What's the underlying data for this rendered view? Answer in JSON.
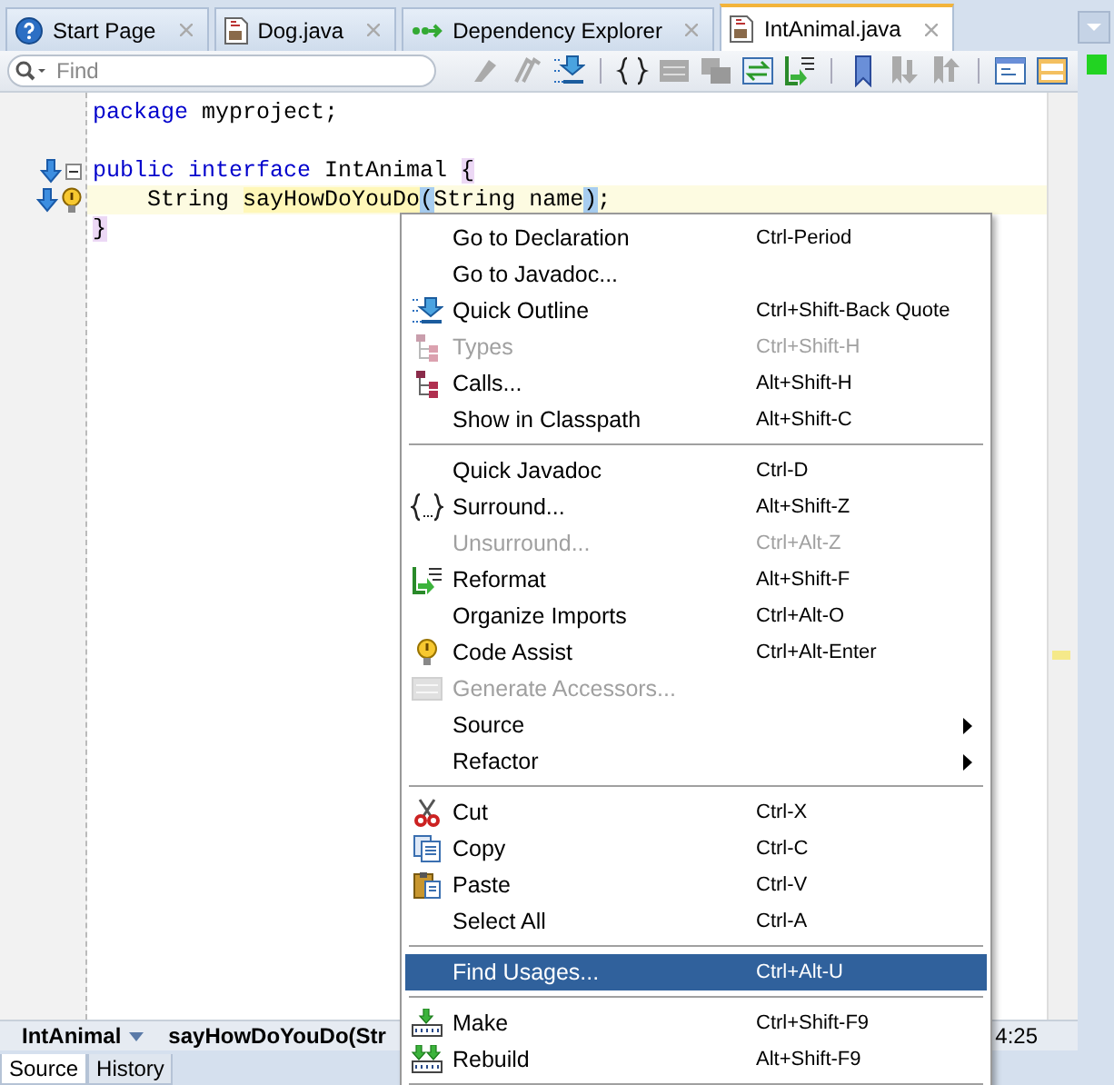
{
  "tabs": [
    {
      "label": "Start Page",
      "selected": false
    },
    {
      "label": "Dog.java",
      "selected": false
    },
    {
      "label": "Dependency Explorer",
      "selected": false
    },
    {
      "label": "IntAnimal.java",
      "selected": true
    }
  ],
  "search": {
    "placeholder": "Find"
  },
  "editor": {
    "lines": [
      {
        "current": false,
        "tokens": [
          {
            "text": "package",
            "kind": "keyword"
          },
          {
            "text": " myproject;",
            "kind": "plain"
          }
        ]
      },
      {
        "current": false,
        "blank_line_before": true,
        "tokens": [
          {
            "text": "public",
            "kind": "keyword"
          },
          {
            "text": " interface",
            "kind": "keyword"
          },
          {
            "text": " IntAnimal ",
            "kind": "plain"
          },
          {
            "text": "{",
            "kind": "brace"
          }
        ]
      },
      {
        "current": true,
        "tokens": [
          {
            "text": "    String ",
            "kind": "plain"
          },
          {
            "text": "sayHowDoYouDo",
            "kind": "mark"
          },
          {
            "text": "(",
            "kind": "paren"
          },
          {
            "text": "String name",
            "kind": "plain"
          },
          {
            "text": ")",
            "kind": "paren"
          },
          {
            "text": ";",
            "kind": "plain"
          }
        ]
      },
      {
        "current": false,
        "tokens": [
          {
            "text": "}",
            "kind": "brace"
          }
        ]
      }
    ]
  },
  "breadcrumb": [
    {
      "label": "IntAnimal",
      "dropdown": true
    },
    {
      "label": "sayHowDoYouDo(Str",
      "dropdown": false
    }
  ],
  "position": "4:25",
  "bottom_tabs": [
    {
      "label": "Source",
      "selected": true
    },
    {
      "label": "History",
      "selected": false
    }
  ],
  "context_menu": [
    {
      "kind": "item",
      "label": "Go to Declaration",
      "shortcut": "Ctrl-Period",
      "disabled": false,
      "selected": false
    },
    {
      "kind": "item",
      "label": "Go to Javadoc...",
      "disabled": false,
      "selected": false
    },
    {
      "kind": "item",
      "label": "Quick Outline",
      "shortcut": "Ctrl+Shift-Back Quote",
      "disabled": false,
      "selected": false
    },
    {
      "kind": "item",
      "label": "Types",
      "shortcut": "Ctrl+Shift-H",
      "disabled": true,
      "selected": false
    },
    {
      "kind": "item",
      "label": "Calls...",
      "shortcut": "Alt+Shift-H",
      "disabled": false,
      "selected": false
    },
    {
      "kind": "item",
      "label": "Show in Classpath",
      "shortcut": "Alt+Shift-C",
      "disabled": false,
      "selected": false
    },
    {
      "kind": "separator"
    },
    {
      "kind": "item",
      "label": "Quick Javadoc",
      "shortcut": "Ctrl-D",
      "disabled": false,
      "selected": false
    },
    {
      "kind": "item",
      "label": "Surround...",
      "shortcut": "Alt+Shift-Z",
      "disabled": false,
      "selected": false
    },
    {
      "kind": "item",
      "label": "Unsurround...",
      "shortcut": "Ctrl+Alt-Z",
      "disabled": true,
      "selected": false
    },
    {
      "kind": "item",
      "label": "Reformat",
      "shortcut": "Alt+Shift-F",
      "disabled": false,
      "selected": false
    },
    {
      "kind": "item",
      "label": "Organize Imports",
      "shortcut": "Ctrl+Alt-O",
      "disabled": false,
      "selected": false
    },
    {
      "kind": "item",
      "label": "Code Assist",
      "shortcut": "Ctrl+Alt-Enter",
      "disabled": false,
      "selected": false
    },
    {
      "kind": "item",
      "label": "Generate Accessors...",
      "disabled": true,
      "selected": false
    },
    {
      "kind": "submenu",
      "label": "Source",
      "disabled": false,
      "selected": false
    },
    {
      "kind": "submenu",
      "label": "Refactor",
      "disabled": false,
      "selected": false
    },
    {
      "kind": "separator"
    },
    {
      "kind": "item",
      "label": "Cut",
      "shortcut": "Ctrl-X",
      "disabled": false,
      "selected": false
    },
    {
      "kind": "item",
      "label": "Copy",
      "shortcut": "Ctrl-C",
      "disabled": false,
      "selected": false
    },
    {
      "kind": "item",
      "label": "Paste",
      "shortcut": "Ctrl-V",
      "disabled": false,
      "selected": false
    },
    {
      "kind": "item",
      "label": "Select All",
      "shortcut": "Ctrl-A",
      "disabled": false,
      "selected": false
    },
    {
      "kind": "separator"
    },
    {
      "kind": "item",
      "label": "Find Usages...",
      "shortcut": "Ctrl+Alt-U",
      "disabled": false,
      "selected": true
    },
    {
      "kind": "separator"
    },
    {
      "kind": "item",
      "label": "Make",
      "shortcut": "Ctrl+Shift-F9",
      "disabled": false,
      "selected": false
    },
    {
      "kind": "item",
      "label": "Rebuild",
      "shortcut": "Alt+Shift-F9",
      "disabled": false,
      "selected": false
    },
    {
      "kind": "separator"
    }
  ]
}
